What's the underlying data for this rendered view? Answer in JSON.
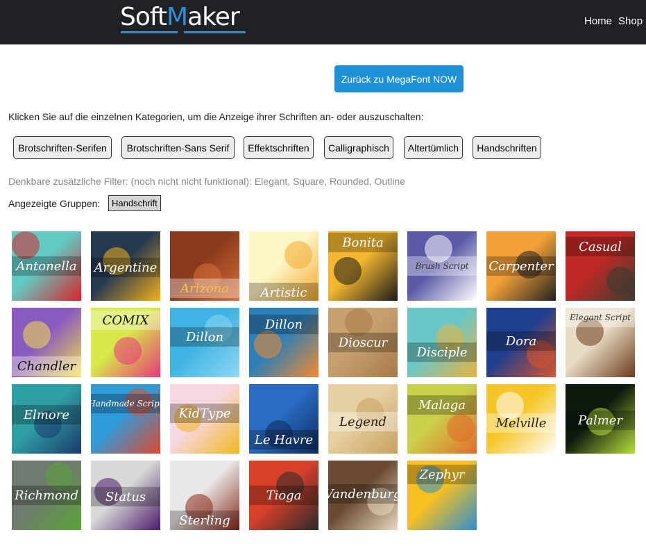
{
  "header": {
    "logo_soft": "Soft",
    "logo_m": "M",
    "logo_aker": "aker",
    "nav_home": "Home",
    "nav_shop": "Shop"
  },
  "back_button": "Zurück zu MegaFont NOW",
  "intro_text": "Klicken Sie auf die einzelnen Kategorien, um die Anzeige ihrer Schriften an- oder auszuschalten:",
  "categories": [
    "Brotschriften-Serifen",
    "Brotschriften-Sans Serif",
    "Effektschriften",
    "Calligraphisch",
    "Altertümlich",
    "Handschriften"
  ],
  "filters_text": "Denkbare zusätzliche Filter: (noch nicht nicht funktional): Elegant, Square, Rounded, Outline",
  "groups_label": "Angezeigte Gruppen:",
  "groups": [
    "Handschrift"
  ],
  "fonts": [
    {
      "name": "Antonella",
      "colors": [
        "#63c9c3",
        "#d8232a",
        "#ffffff"
      ]
    },
    {
      "name": "Argentine",
      "colors": [
        "#24384f",
        "#f3b01c",
        "#ffffff"
      ]
    },
    {
      "name": "Arizona",
      "colors": [
        "#8a3a1c",
        "#d9703a",
        "#f2c14b"
      ]
    },
    {
      "name": "Artistic",
      "colors": [
        "#fff6c7",
        "#f0a92e",
        "#ffffff"
      ]
    },
    {
      "name": "Bonita",
      "colors": [
        "#f5b72f",
        "#1a1a1a",
        "#ffffff"
      ]
    },
    {
      "name": "Brush Script",
      "colors": [
        "#5a58a7",
        "#ffffff",
        "#333333"
      ]
    },
    {
      "name": "Carpenter",
      "colors": [
        "#f4a13a",
        "#222222",
        "#ffffff"
      ]
    },
    {
      "name": "Casual",
      "colors": [
        "#c02a26",
        "#3b3b2f",
        "#ffffff"
      ]
    },
    {
      "name": "Chandler",
      "colors": [
        "#8a5bbf",
        "#f3e04c",
        "#111111"
      ]
    },
    {
      "name": "COMIX",
      "colors": [
        "#d8e84b",
        "#e8387a",
        "#111111"
      ]
    },
    {
      "name": "Dillon",
      "colors": [
        "#3fb3e3",
        "#8ed8f4",
        "#ffffff"
      ]
    },
    {
      "name": "Dillon",
      "colors": [
        "#2c7fb8",
        "#f28a2e",
        "#ffffff"
      ]
    },
    {
      "name": "Dioscur",
      "colors": [
        "#c8a070",
        "#a57a48",
        "#ffffff"
      ]
    },
    {
      "name": "Disciple",
      "colors": [
        "#6ac7c9",
        "#e8b33c",
        "#ffffff"
      ]
    },
    {
      "name": "Dora",
      "colors": [
        "#1f3f8f",
        "#d8542a",
        "#ffffff"
      ]
    },
    {
      "name": "Elegant Script",
      "colors": [
        "#e8dcc4",
        "#6b3b1e",
        "#333333"
      ]
    },
    {
      "name": "Elmore",
      "colors": [
        "#2f9fa6",
        "#1a3a6b",
        "#ffffff"
      ]
    },
    {
      "name": "Handmade Script",
      "colors": [
        "#2f9bd8",
        "#e0482e",
        "#ffffff"
      ]
    },
    {
      "name": "KidType",
      "colors": [
        "#f7d8e0",
        "#f2b71f",
        "#ffffff"
      ]
    },
    {
      "name": "Le Havre",
      "colors": [
        "#2a6cc4",
        "#0d2a5c",
        "#ffffff"
      ]
    },
    {
      "name": "Legend",
      "colors": [
        "#e6cfa0",
        "#c8a060",
        "#2a1a10"
      ]
    },
    {
      "name": "Malaga",
      "colors": [
        "#c9d14a",
        "#e26b2c",
        "#ffffff"
      ]
    },
    {
      "name": "Melville",
      "colors": [
        "#f6c628",
        "#ffffff",
        "#222222"
      ]
    },
    {
      "name": "Palmer",
      "colors": [
        "#0e1a0e",
        "#b8e03a",
        "#ffffff"
      ]
    },
    {
      "name": "Richmond",
      "colors": [
        "#6f7a70",
        "#5ba338",
        "#ffffff"
      ]
    },
    {
      "name": "Status",
      "colors": [
        "#d8d8d8",
        "#4a1a6a",
        "#ffffff"
      ]
    },
    {
      "name": "Sterling",
      "colors": [
        "#e8e8e8",
        "#8a2a1a",
        "#ffffff"
      ]
    },
    {
      "name": "Tioga",
      "colors": [
        "#d8402a",
        "#2a2a2a",
        "#ffffff"
      ]
    },
    {
      "name": "Vandenburg",
      "colors": [
        "#6a4a32",
        "#e8d8c0",
        "#ffffff"
      ]
    },
    {
      "name": "Zephyr",
      "colors": [
        "#f7c01f",
        "#2f8fd0",
        "#ffffff"
      ]
    }
  ]
}
